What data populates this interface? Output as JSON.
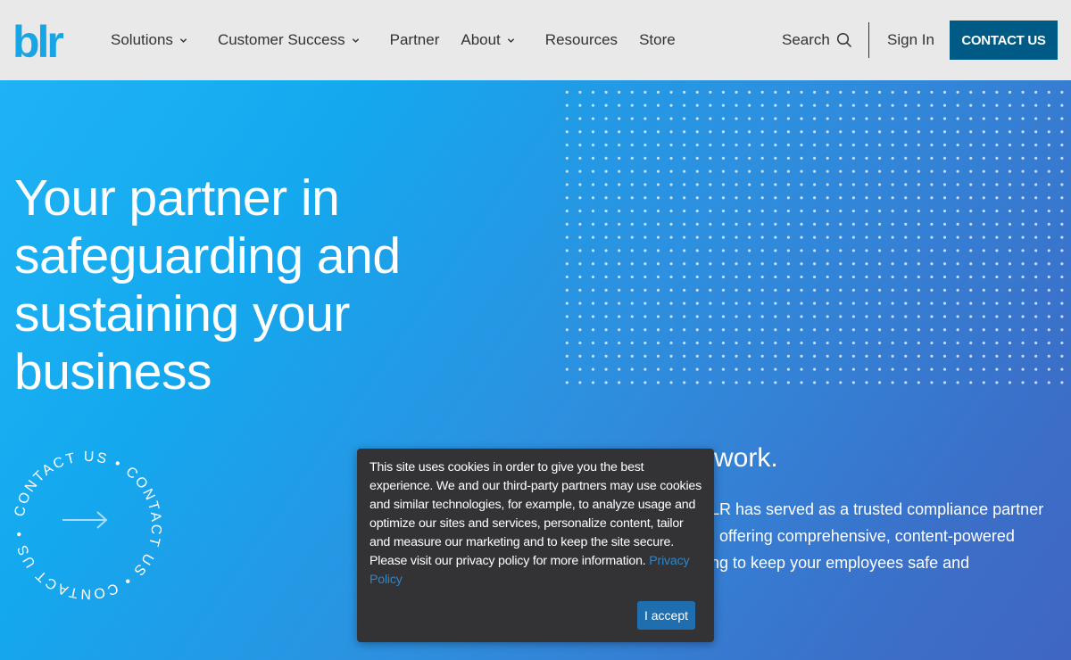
{
  "header": {
    "logo_text": "blr",
    "nav": [
      {
        "label": "Solutions",
        "has_dropdown": true
      },
      {
        "label": "Customer Success",
        "has_dropdown": true
      },
      {
        "label": "Partner",
        "has_dropdown": false
      },
      {
        "label": "About",
        "has_dropdown": true
      },
      {
        "label": "Resources",
        "has_dropdown": false
      },
      {
        "label": "Store",
        "has_dropdown": false
      }
    ],
    "search_label": "Search",
    "signin_label": "Sign In",
    "contact_label": "CONTACT US"
  },
  "hero": {
    "title": "Your partner in safeguarding and sustaining your business",
    "circle_text": "CONTACT US • CONTACT US • CONTACT US •",
    "subhead": "work.",
    "body_lines": [
      "LR has served as a trusted compliance partner",
      ", offering comprehensive, content-powered",
      "ng to keep your employees safe and"
    ]
  },
  "cookie": {
    "text": "This site uses cookies in order to give you the best experience. We and our third-party partners may use cookies and similar technologies, for example, to analyze usage and optimize our sites and services, personalize content, tailor and measure our marketing and to keep the site secure. Please visit our privacy policy for more information.",
    "link_label": "Privacy Policy",
    "accept_label": "I accept"
  },
  "colors": {
    "brand_blue": "#00a4e4",
    "contact_button": "#005a86",
    "accept_button": "#1f6fb0",
    "cookie_bg": "#333335"
  }
}
